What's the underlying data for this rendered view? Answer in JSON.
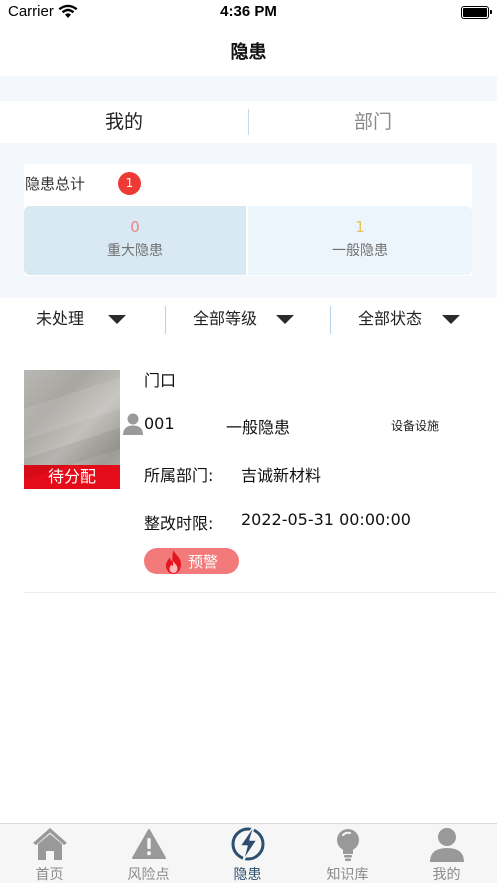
{
  "status_bar": {
    "carrier": "Carrier",
    "time": "4:36 PM"
  },
  "nav": {
    "title": "隐患"
  },
  "segments": {
    "mine": "我的",
    "department": "部门"
  },
  "summary": {
    "label": "隐患总计",
    "badge": "1",
    "major": {
      "count": "0",
      "label": "重大隐患",
      "color": "#f08080"
    },
    "general": {
      "count": "1",
      "label": "一般隐患",
      "color": "#e4c45b"
    }
  },
  "filters": {
    "process": "未处理",
    "level": "全部等级",
    "status": "全部状态"
  },
  "item": {
    "location": "门口",
    "code": "001",
    "type": "一般隐患",
    "category": "设备设施",
    "dept_label": "所属部门:",
    "dept_value": "吉诚新材料",
    "deadline_label": "整改时限:",
    "deadline_value": "2022-05-31 00:00:00",
    "status_tag": "待分配",
    "warning": "预警",
    "status_color": "#e50c19"
  },
  "tabbar": {
    "home": "首页",
    "risk": "风险点",
    "hazard": "隐患",
    "knowledge": "知识库",
    "mine": "我的",
    "active_color": "#2d4e6f"
  }
}
